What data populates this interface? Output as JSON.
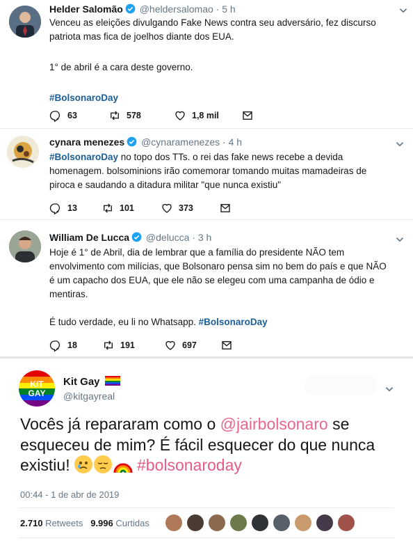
{
  "tweets": [
    {
      "name": "Helder Salomão",
      "handle": "@heldersalomao",
      "time": "· 5 h",
      "lines": [
        "Venceu as eleições divulgando Fake News contra seu adversário, fez  discurso",
        "patriota mas fica de joelhos diante dos EUA.",
        "",
        "1° de abril é a cara deste governo.",
        ""
      ],
      "hashtag": "#BolsonaroDay",
      "replies": "63",
      "retweets": "578",
      "likes": "1,8 mil"
    },
    {
      "name": "cynara menezes",
      "handle": "@cynaramenezes",
      "time": "· 4 h",
      "hashtag": "#BolsonaroDay",
      "line1_rest": " no topo dos TTs. o rei das fake news recebe a devida",
      "line2": "homenagem. bolsominions irão comemorar tomando muitas mamadeiras de",
      "line3": "piroca e saudando a ditadura militar \"que nunca existiu\"",
      "replies": "13",
      "retweets": "101",
      "likes": "373"
    },
    {
      "name": "William De Lucca",
      "handle": "@delucca",
      "time": "· 3 h",
      "line1": "Hoje é 1° de Abril, dia de lembrar que a família do presidente NÃO tem",
      "line2": "envolvimento com milícias, que Bolsonaro pensa sim no bem do país e que NÃO",
      "line3": "é um capacho dos EUA, que ele não se elegeu com uma campanha de ódio e",
      "line4": "mentiras.",
      "line5": "É tudo verdade, eu li no Whatsapp. ",
      "hashtag": "#BolsonaroDay",
      "replies": "18",
      "retweets": "191",
      "likes": "697"
    }
  ],
  "kit": {
    "name": "Kit Gay",
    "handle": "@kitgayreal",
    "avatar_text_1": "KIT",
    "avatar_text_2": "GAY",
    "text_1": "Vocês já repararam como o ",
    "mention": "@jairbolsonaro",
    "text_2": " se esqueceu de mim? É fácil esquecer do que nunca existiu! ",
    "hashtag": "#bolsonaroday",
    "timestamp": "00:44 - 1 de abr de 2019",
    "retweets_count": "2.710",
    "retweets_label": "Retweets",
    "likes_count": "9.996",
    "likes_label": "Curtidas"
  },
  "colors": {
    "verified": "#1da1f2",
    "hashtag": "#1b5f96",
    "mention": "#e0245e"
  }
}
